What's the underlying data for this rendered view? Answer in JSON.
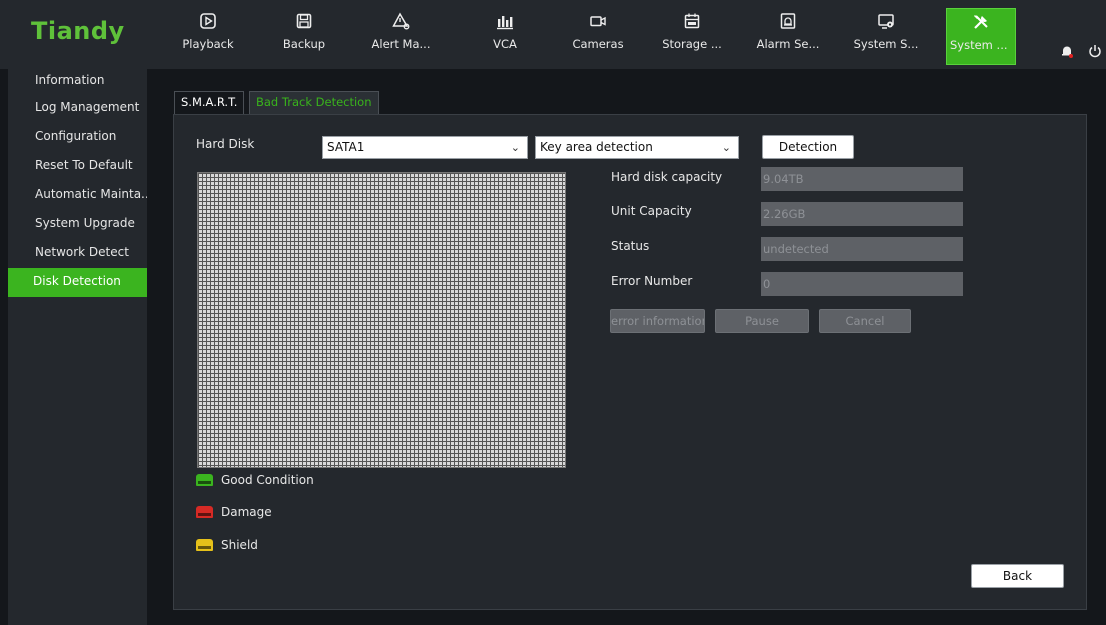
{
  "brand": "Tiandy",
  "colors": {
    "accent": "#3bb41f",
    "good": "#3bb41f",
    "damage": "#d62a25",
    "shield": "#e6c11a"
  },
  "nav": [
    {
      "label": "Playback",
      "icon": "playback-icon"
    },
    {
      "label": "Backup",
      "icon": "save-icon"
    },
    {
      "label": "Alert Ma...",
      "icon": "alert-icon"
    },
    {
      "label": "VCA",
      "icon": "vca-icon"
    },
    {
      "label": "Cameras",
      "icon": "camera-icon"
    },
    {
      "label": "Storage ...",
      "icon": "storage-icon"
    },
    {
      "label": "Alarm Se...",
      "icon": "alarm-icon"
    },
    {
      "label": "System S...",
      "icon": "monitor-gear-icon"
    },
    {
      "label": "System ...",
      "icon": "tools-icon",
      "active": true
    }
  ],
  "sidebar": {
    "items": [
      {
        "label": "Information"
      },
      {
        "label": "Log Management"
      },
      {
        "label": "Configuration"
      },
      {
        "label": "Reset To Default"
      },
      {
        "label": "Automatic Mainta..."
      },
      {
        "label": "System Upgrade"
      },
      {
        "label": "Network Detect"
      },
      {
        "label": "Disk Detection",
        "active": true
      }
    ]
  },
  "tabs": {
    "smart": "S.M.A.R.T.",
    "bad_track": "Bad Track Detection"
  },
  "form": {
    "hard_disk_label": "Hard Disk",
    "hard_disk_value": "SATA1",
    "mode_value": "Key area detection",
    "detection_button": "Detection"
  },
  "legend": {
    "good": "Good Condition",
    "damage": "Damage",
    "shield": "Shield"
  },
  "info": {
    "capacity_label": "Hard disk capacity",
    "capacity_value": "9.04TB",
    "unit_label": "Unit Capacity",
    "unit_value": "2.26GB",
    "status_label": "Status",
    "status_value": "undetected",
    "error_label": "Error Number",
    "error_value": "0"
  },
  "actions": {
    "error_info": "error information",
    "pause": "Pause",
    "cancel": "Cancel",
    "back": "Back"
  }
}
